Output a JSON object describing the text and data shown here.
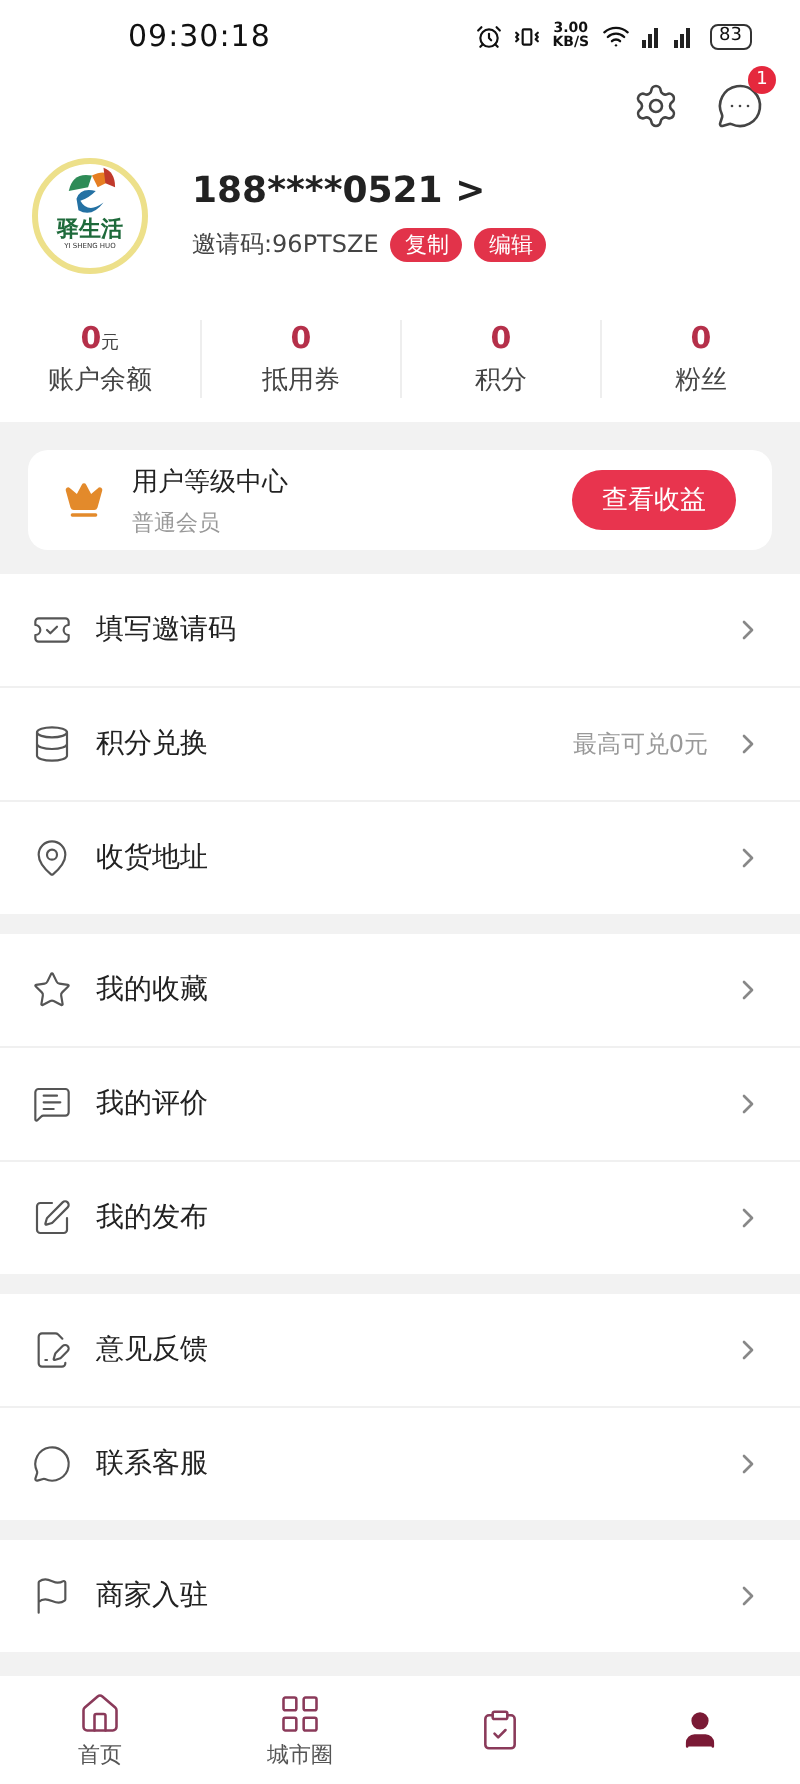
{
  "status_bar": {
    "time": "09:30:18",
    "speed": "3.00",
    "speed_unit": "KB/S",
    "battery": "83"
  },
  "header": {
    "message_badge": "1"
  },
  "profile": {
    "logo_text": "驿生活",
    "logo_subtext": "YI SHENG HUO",
    "phone": "188****0521 >",
    "invite_label": "邀请码:96PTSZE",
    "actions": [
      "复制",
      "编辑"
    ]
  },
  "stats": [
    {
      "value": "0",
      "unit": "元",
      "label": "账户余额"
    },
    {
      "value": "0",
      "label": "抵用券"
    },
    {
      "value": "0",
      "label": "积分"
    },
    {
      "value": "0",
      "label": "粉丝"
    }
  ],
  "level_card": {
    "title": "用户等级中心",
    "subtitle": "普通会员",
    "button": "查看收益"
  },
  "menu_sections": [
    [
      {
        "label": "填写邀请码"
      },
      {
        "label": "积分兑换",
        "note": "最高可兑0元"
      },
      {
        "label": "收货地址"
      }
    ],
    [
      {
        "label": "我的收藏"
      },
      {
        "label": "我的评价"
      },
      {
        "label": "我的发布"
      }
    ],
    [
      {
        "label": "意见反馈"
      },
      {
        "label": "联系客服"
      }
    ],
    [
      {
        "label": "商家入驻"
      }
    ]
  ],
  "tabs": [
    {
      "label": "首页",
      "selected": false
    },
    {
      "label": "城市圈",
      "selected": false
    },
    {
      "selected": false
    },
    {
      "selected": true
    }
  ]
}
